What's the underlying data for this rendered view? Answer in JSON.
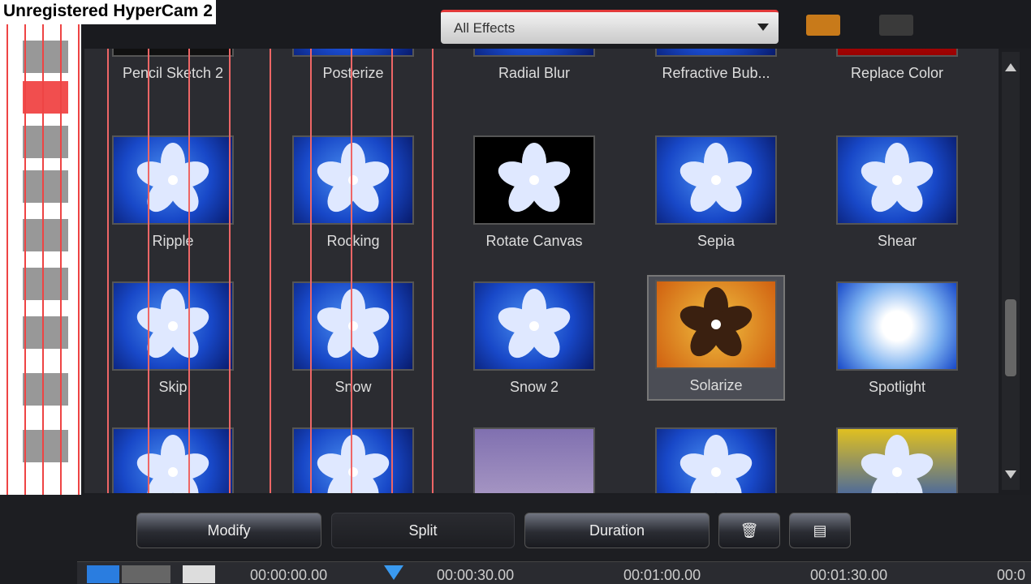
{
  "watermark": "Unregistered HyperCam 2",
  "filter": {
    "selected": "All Effects"
  },
  "effects": [
    {
      "name": "Pencil Sketch 2",
      "style": "dark"
    },
    {
      "name": "Posterize",
      "style": "blue"
    },
    {
      "name": "Radial Blur",
      "style": "blue"
    },
    {
      "name": "Refractive Bub...",
      "style": "blue"
    },
    {
      "name": "Replace Color",
      "style": "red"
    },
    {
      "name": "Ripple",
      "style": "blue"
    },
    {
      "name": "Rocking",
      "style": "blue"
    },
    {
      "name": "Rotate Canvas",
      "style": "canvas"
    },
    {
      "name": "Sepia",
      "style": "blue"
    },
    {
      "name": "Shear",
      "style": "blue"
    },
    {
      "name": "Skip",
      "style": "blue"
    },
    {
      "name": "Snow",
      "style": "blue"
    },
    {
      "name": "Snow 2",
      "style": "blue"
    },
    {
      "name": "Solarize",
      "style": "solar",
      "selected": true
    },
    {
      "name": "Spotlight",
      "style": "spot"
    },
    {
      "name": "",
      "style": "blue"
    },
    {
      "name": "",
      "style": "blue"
    },
    {
      "name": "",
      "style": "text"
    },
    {
      "name": "",
      "style": "blue"
    },
    {
      "name": "",
      "style": "textcolor"
    }
  ],
  "toolbar": {
    "modify": "Modify",
    "split": "Split",
    "duration": "Duration"
  },
  "timeline": {
    "ticks": [
      "00:00:00.00",
      "00:00:30.00",
      "00:01:00.00",
      "00:01:30.00",
      "00:0"
    ]
  }
}
